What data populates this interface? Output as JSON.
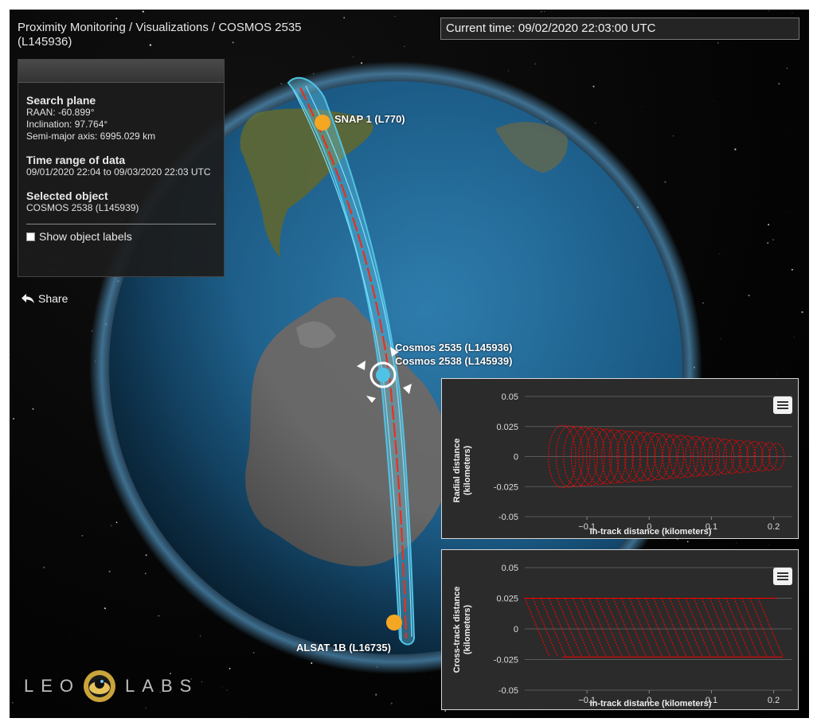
{
  "header": {
    "breadcrumb": "Proximity Monitoring / Visualizations / COSMOS 2535 (L145936)",
    "current_time": "Current time: 09/02/2020 22:03:00 UTC"
  },
  "info_panel": {
    "search_plane": {
      "title": "Search plane",
      "raan": "RAAN: -60.899°",
      "inclination": "Inclination: 97.764°",
      "semi_major_axis": "Semi-major axis: 6995.029 km"
    },
    "time_range": {
      "title": "Time range of data",
      "value": "09/01/2020 22:04 to 09/03/2020 22:03 UTC"
    },
    "selected_object": {
      "title": "Selected object",
      "value": "COSMOS 2538 (L145939)"
    },
    "show_labels": "Show object labels"
  },
  "share_label": "Share",
  "globe_labels": {
    "snap": "SNAP 1 (L770)",
    "cosmos_2535": "Cosmos 2535 (L145936)",
    "cosmos_2538": "Cosmos 2538 (L145939)",
    "alsat": "ALSAT 1B (L16735)"
  },
  "logo": {
    "left": "LEO",
    "right": "LABS"
  },
  "colors": {
    "orbit_blue": "#4fc3e6",
    "orbit_red": "#e8301f",
    "satellite": "#f5a623",
    "series": "#ff0000"
  },
  "chart_data": [
    {
      "type": "scatter",
      "name": "radial-vs-intrack",
      "xlabel": "In-track distance (kilometers)",
      "ylabel": "Radial distance (kilometers)",
      "xlim": [
        -0.2,
        0.23
      ],
      "ylim": [
        -0.05,
        0.05
      ],
      "xticks": [
        "-0.1",
        "0",
        "0.1",
        "0.2"
      ],
      "yticks": [
        "0.05",
        "0.025",
        "0",
        "-0.025",
        "-0.05"
      ],
      "loops": {
        "count": 30,
        "x_start": -0.14,
        "x_end": 0.205,
        "radius_x_start": 0.022,
        "radius_x_end": 0.012,
        "radius_y_start": 0.026,
        "radius_y_end": 0.011
      }
    },
    {
      "type": "scatter",
      "name": "crosstrack-vs-intrack",
      "xlabel": "In-track distance (kilometers)",
      "ylabel": "Cross-track distance (kilometers)",
      "xlim": [
        -0.2,
        0.23
      ],
      "ylim": [
        -0.05,
        0.05
      ],
      "xticks": [
        "-0.1",
        "0",
        "0.1",
        "0.2"
      ],
      "yticks": [
        "0.05",
        "0.025",
        "0",
        "-0.025",
        "-0.05"
      ],
      "streaks": {
        "count": 30,
        "x_start": -0.2,
        "x_end": 0.175,
        "y_top": 0.025,
        "y_bottom": -0.023,
        "slope_dx": 0.04
      }
    }
  ]
}
